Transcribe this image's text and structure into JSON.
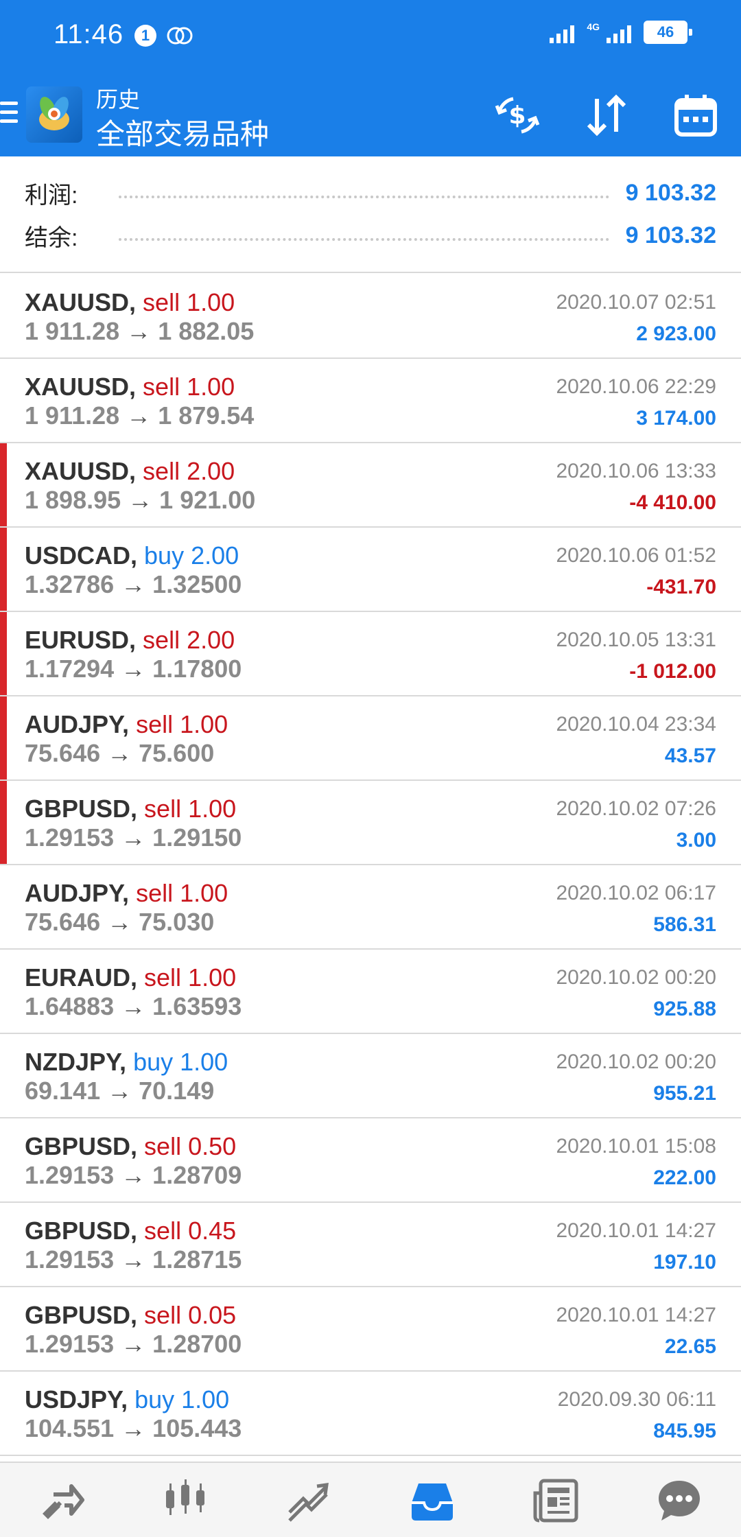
{
  "status_bar": {
    "time": "11:46",
    "notification_count": "1",
    "network_type": "4G",
    "battery": "46"
  },
  "app_bar": {
    "subtitle": "历史",
    "title": "全部交易品种",
    "icons": [
      "menu-icon",
      "app-logo",
      "currency-exchange-icon",
      "sort-icon",
      "calendar-icon"
    ]
  },
  "summary": {
    "profit_label": "利润:",
    "profit_value": "9 103.32",
    "balance_label": "结余:",
    "balance_value": "9 103.32"
  },
  "colors": {
    "accent": "#1a7fe8",
    "loss": "#c8161d",
    "marker": "#d8262b"
  },
  "trades": [
    {
      "symbol": "XAUUSD,",
      "type": "sell 1.00",
      "open": "1 911.28",
      "close": "1 882.05",
      "time": "2020.10.07 02:51",
      "profit": "2 923.00"
    },
    {
      "symbol": "XAUUSD,",
      "type": "sell 1.00",
      "open": "1 911.28",
      "close": "1 879.54",
      "time": "2020.10.06 22:29",
      "profit": "3 174.00"
    },
    {
      "symbol": "XAUUSD,",
      "type": "sell 2.00",
      "open": "1 898.95",
      "close": "1 921.00",
      "time": "2020.10.06 13:33",
      "profit": "-4 410.00"
    },
    {
      "symbol": "USDCAD,",
      "type": "buy 2.00",
      "open": "1.32786",
      "close": "1.32500",
      "time": "2020.10.06 01:52",
      "profit": "-431.70"
    },
    {
      "symbol": "EURUSD,",
      "type": "sell 2.00",
      "open": "1.17294",
      "close": "1.17800",
      "time": "2020.10.05 13:31",
      "profit": "-1 012.00"
    },
    {
      "symbol": "AUDJPY,",
      "type": "sell 1.00",
      "open": "75.646",
      "close": "75.600",
      "time": "2020.10.04 23:34",
      "profit": "43.57"
    },
    {
      "symbol": "GBPUSD,",
      "type": "sell 1.00",
      "open": "1.29153",
      "close": "1.29150",
      "time": "2020.10.02 07:26",
      "profit": "3.00"
    },
    {
      "symbol": "AUDJPY,",
      "type": "sell 1.00",
      "open": "75.646",
      "close": "75.030",
      "time": "2020.10.02 06:17",
      "profit": "586.31"
    },
    {
      "symbol": "EURAUD,",
      "type": "sell 1.00",
      "open": "1.64883",
      "close": "1.63593",
      "time": "2020.10.02 00:20",
      "profit": "925.88"
    },
    {
      "symbol": "NZDJPY,",
      "type": "buy 1.00",
      "open": "69.141",
      "close": "70.149",
      "time": "2020.10.02 00:20",
      "profit": "955.21"
    },
    {
      "symbol": "GBPUSD,",
      "type": "sell 0.50",
      "open": "1.29153",
      "close": "1.28709",
      "time": "2020.10.01 15:08",
      "profit": "222.00"
    },
    {
      "symbol": "GBPUSD,",
      "type": "sell 0.45",
      "open": "1.29153",
      "close": "1.28715",
      "time": "2020.10.01 14:27",
      "profit": "197.10"
    },
    {
      "symbol": "GBPUSD,",
      "type": "sell 0.05",
      "open": "1.29153",
      "close": "1.28700",
      "time": "2020.10.01 14:27",
      "profit": "22.65"
    },
    {
      "symbol": "USDJPY,",
      "type": "buy 1.00",
      "open": "104.551",
      "close": "105.443",
      "time": "2020.09.30 06:11",
      "profit": "845.95"
    }
  ],
  "bottom_nav": {
    "items": [
      "quotes-icon",
      "chart-icon",
      "trade-icon",
      "history-icon",
      "news-icon",
      "chat-icon"
    ],
    "active": "history-icon"
  }
}
